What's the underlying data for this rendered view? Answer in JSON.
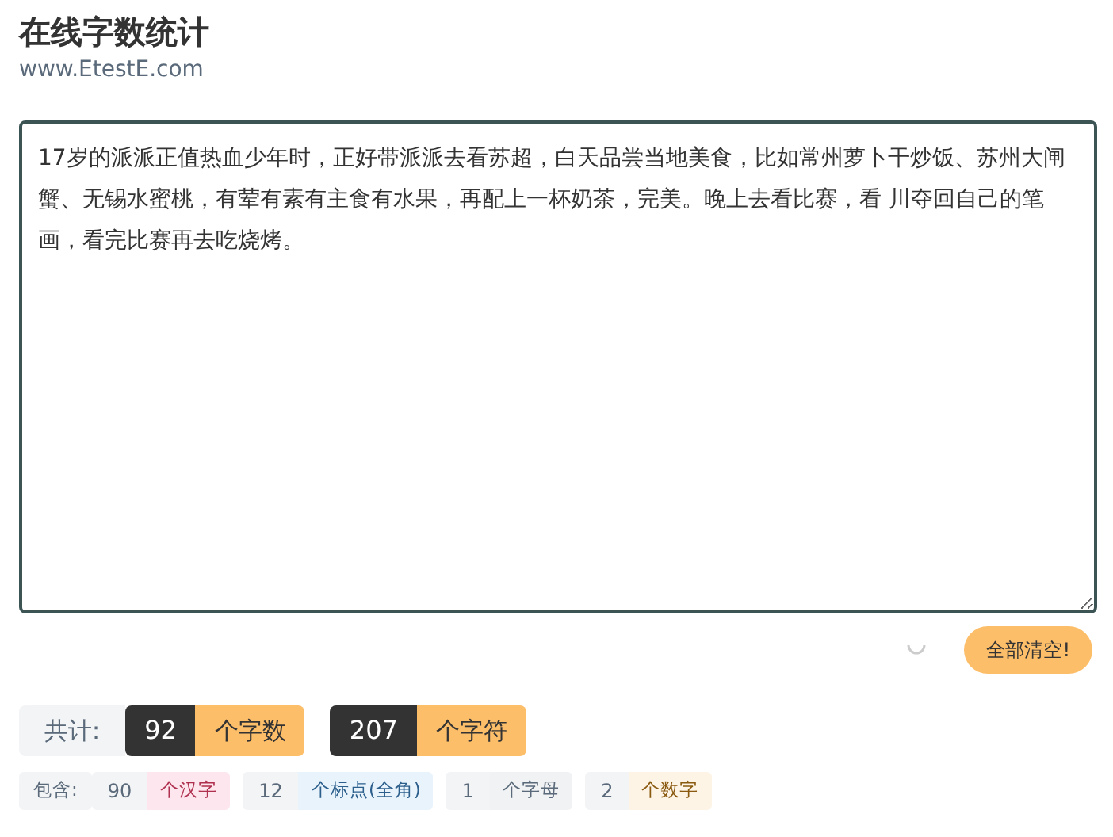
{
  "title": "在线字数统计",
  "subtitle": "www.EtestE.com",
  "text": "17岁的派派正值热血少年时，正好带派派去看苏超，白天品尝当地美食，比如常州萝卜干炒饭、苏州大闸蟹、无锡水蜜桃，有荤有素有主食有水果，再配上一杯奶茶，完美。晚上去看比赛，看 川夺回自己的笔画，看完比赛再去吃烧烤。",
  "clear_button": "全部清空!",
  "totals": {
    "label": "共计:",
    "items": [
      {
        "count": "92",
        "unit": "个字数"
      },
      {
        "count": "207",
        "unit": "个字符"
      }
    ]
  },
  "details": {
    "label": "包含:",
    "items": [
      {
        "count": "90",
        "unit": "个汉字",
        "color": "#fde6ee"
      },
      {
        "count": "12",
        "unit": "个标点(全角)",
        "color": "#e8f3fc"
      },
      {
        "count": "1",
        "unit": "个字母",
        "color": "#f1f2f4"
      },
      {
        "count": "2",
        "unit": "个数字",
        "color": "#fdf4e6"
      }
    ]
  }
}
